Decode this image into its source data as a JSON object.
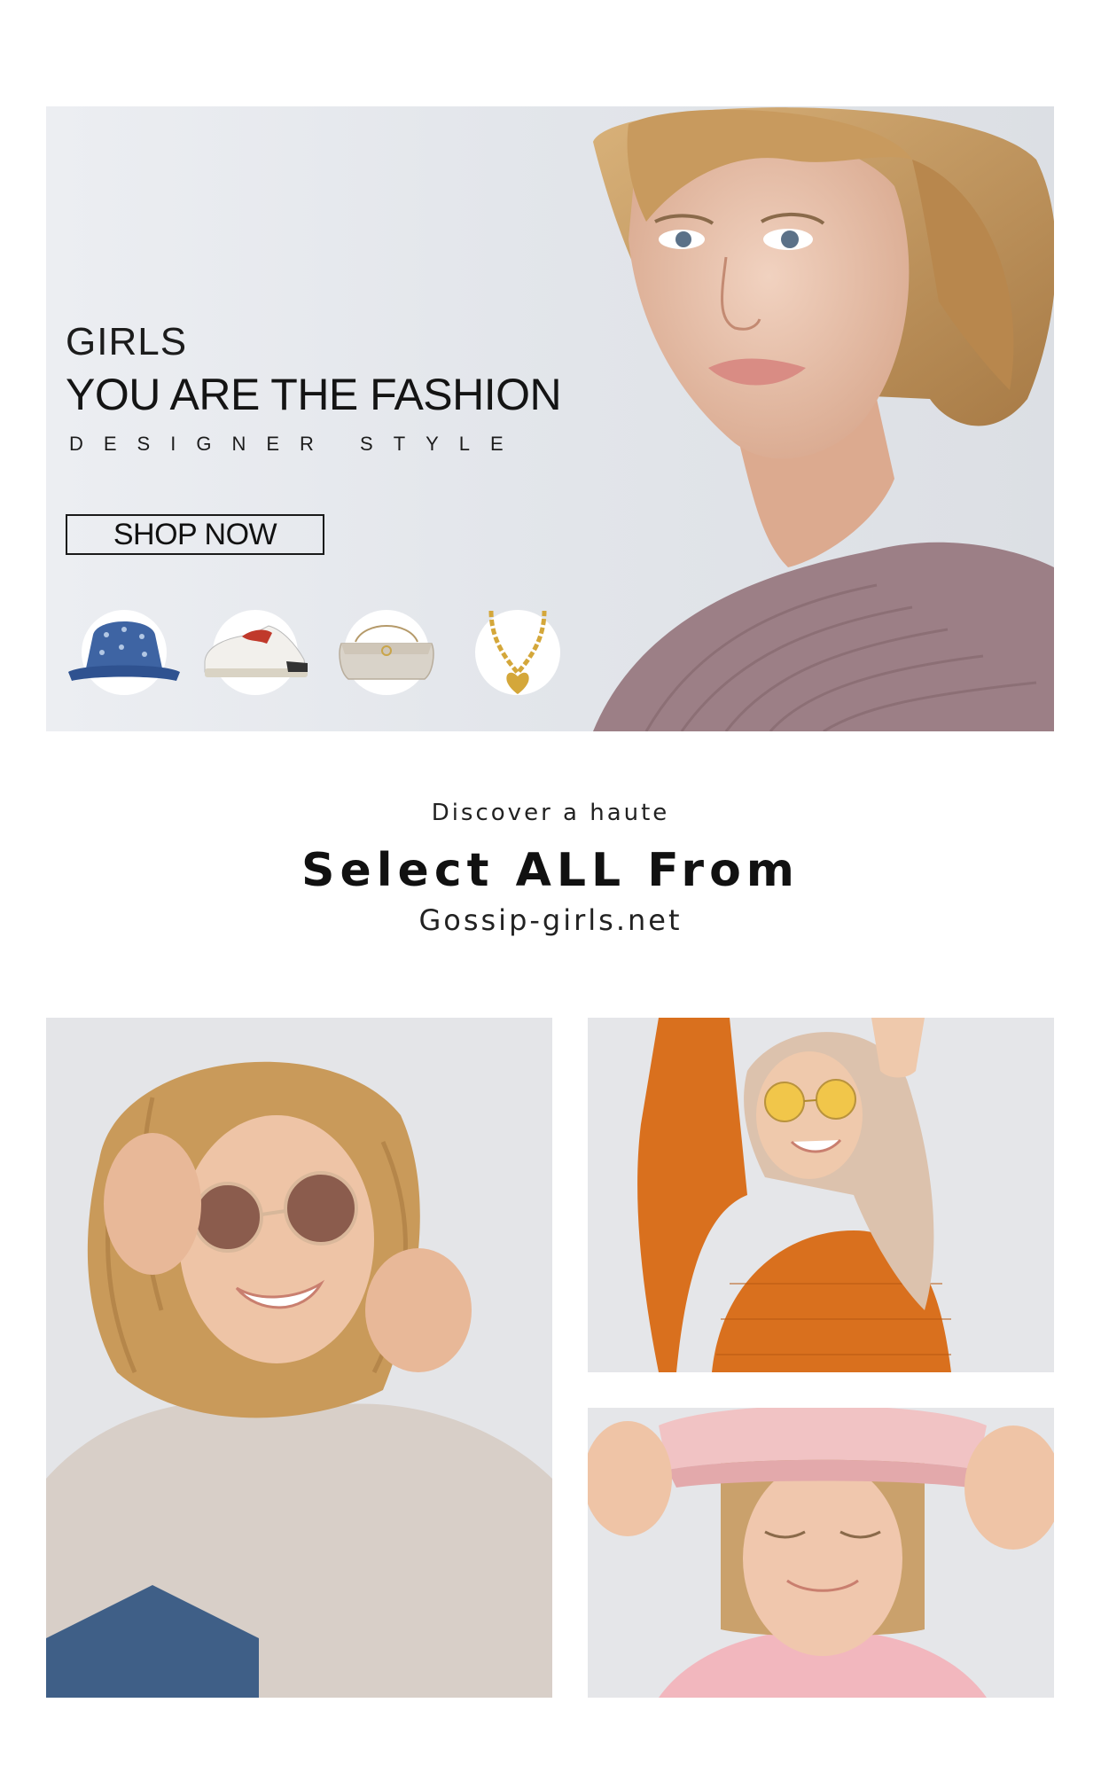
{
  "hero": {
    "kicker": "GIRLS",
    "headline": "YOU ARE THE FASHION",
    "subline": "DESIGNER STYLE",
    "cta_label": "SHOP NOW",
    "products": [
      {
        "icon": "bucket-hat-icon"
      },
      {
        "icon": "sneaker-icon"
      },
      {
        "icon": "handbag-icon"
      },
      {
        "icon": "heart-necklace-icon"
      }
    ]
  },
  "section": {
    "eyebrow": "Discover a haute",
    "title": "Select ALL From",
    "site": "Gossip-girls.net"
  },
  "gallery": {
    "tiles": [
      {
        "subject": "woman-sunglasses-sweater"
      },
      {
        "subject": "woman-orange-sweater"
      },
      {
        "subject": "woman-pink-cap"
      }
    ]
  },
  "colors": {
    "background": "#ffffff",
    "text": "#111111",
    "banner": "#e3e6eb"
  }
}
